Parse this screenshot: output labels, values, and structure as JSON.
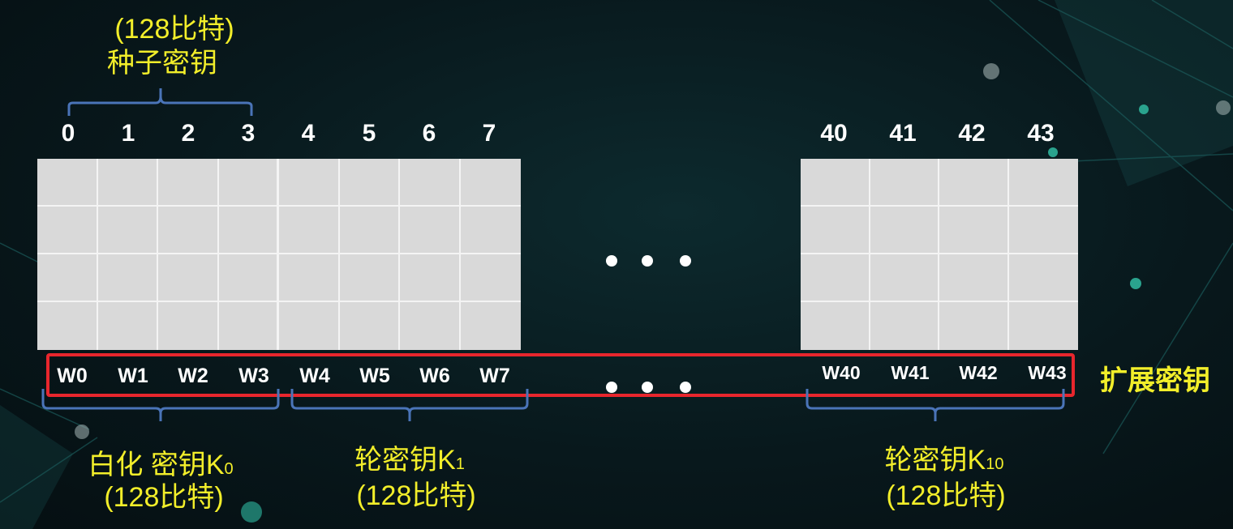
{
  "seed_key": {
    "bits": "(128比特)",
    "label": "种子密钥"
  },
  "indices_left": [
    "0",
    "1",
    "2",
    "3",
    "4",
    "5",
    "6",
    "7"
  ],
  "indices_right": [
    "40",
    "41",
    "42",
    "43"
  ],
  "words_left": [
    "W0",
    "W1",
    "W2",
    "W3",
    "W4",
    "W5",
    "W6",
    "W7"
  ],
  "words_right": [
    "W40",
    "W41",
    "W42",
    "W43"
  ],
  "expanded_key_label": "扩展密钥",
  "k0": {
    "label": "白化 密钥K",
    "sub": "0",
    "bits": "(128比特)"
  },
  "k1": {
    "label": "轮密钥K",
    "sub": "1",
    "bits": "(128比特)"
  },
  "k10": {
    "label": "轮密钥K",
    "sub": "10",
    "bits": "(128比特)"
  },
  "colors": {
    "label_yellow": "#f2ee2a",
    "bracket_blue": "#4a74b8",
    "highlight_red": "#e8262d",
    "cell_gray": "#d9d9d9"
  }
}
